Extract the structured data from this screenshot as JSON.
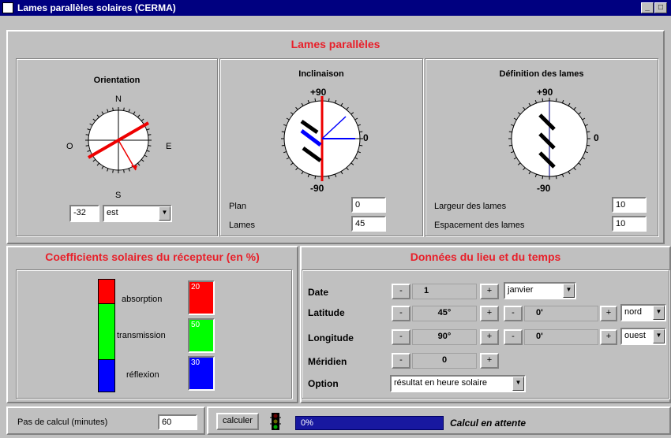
{
  "window": {
    "title": "Lames parallèles solaires (CERMA)",
    "min": "_",
    "max": "□"
  },
  "top": {
    "header": "Lames parallèles",
    "orientation": {
      "title": "Orientation",
      "n": "N",
      "s": "S",
      "e": "E",
      "o": "O",
      "value": "-32",
      "direction": "est"
    },
    "inclinaison": {
      "title": "Inclinaison",
      "top": "+90",
      "bottom": "-90",
      "right": "0",
      "plan_label": "Plan",
      "plan_value": "0",
      "lames_label": "Lames",
      "lames_value": "45"
    },
    "definition": {
      "title": "Définition des lames",
      "top": "+90",
      "bottom": "-90",
      "right": "0",
      "largeur_label": "Largeur des lames",
      "largeur_value": "10",
      "espacement_label": "Espacement des lames",
      "espacement_value": "10"
    }
  },
  "coeff": {
    "header": "Coefficients solaires du récepteur (en %)",
    "absorption": {
      "label": "absorption",
      "value": "20"
    },
    "transmission": {
      "label": "transmission",
      "value": "50"
    },
    "reflexion": {
      "label": "réflexion",
      "value": "30"
    },
    "colors": {
      "absorption": "#ff0000",
      "transmission": "#00ff00",
      "reflexion": "#0000ff"
    }
  },
  "donnees": {
    "header": "Données du lieu et du temps",
    "date_label": "Date",
    "date_day": "1",
    "date_month": "janvier",
    "lat_label": "Latitude",
    "lat_deg": "45°",
    "lat_min": "0'",
    "lat_dir": "nord",
    "lon_label": "Longitude",
    "lon_deg": "90°",
    "lon_min": "0'",
    "lon_dir": "ouest",
    "mer_label": "Méridien",
    "mer_value": "0",
    "opt_label": "Option",
    "opt_value": "résultat en heure solaire",
    "minus": "-",
    "plus": "+"
  },
  "bottom": {
    "pas_label": "Pas de calcul (minutes)",
    "pas_value": "60",
    "calc_button": "calculer",
    "progress_text": "0%",
    "progress_fraction": 0,
    "status": "Calcul en attente"
  }
}
